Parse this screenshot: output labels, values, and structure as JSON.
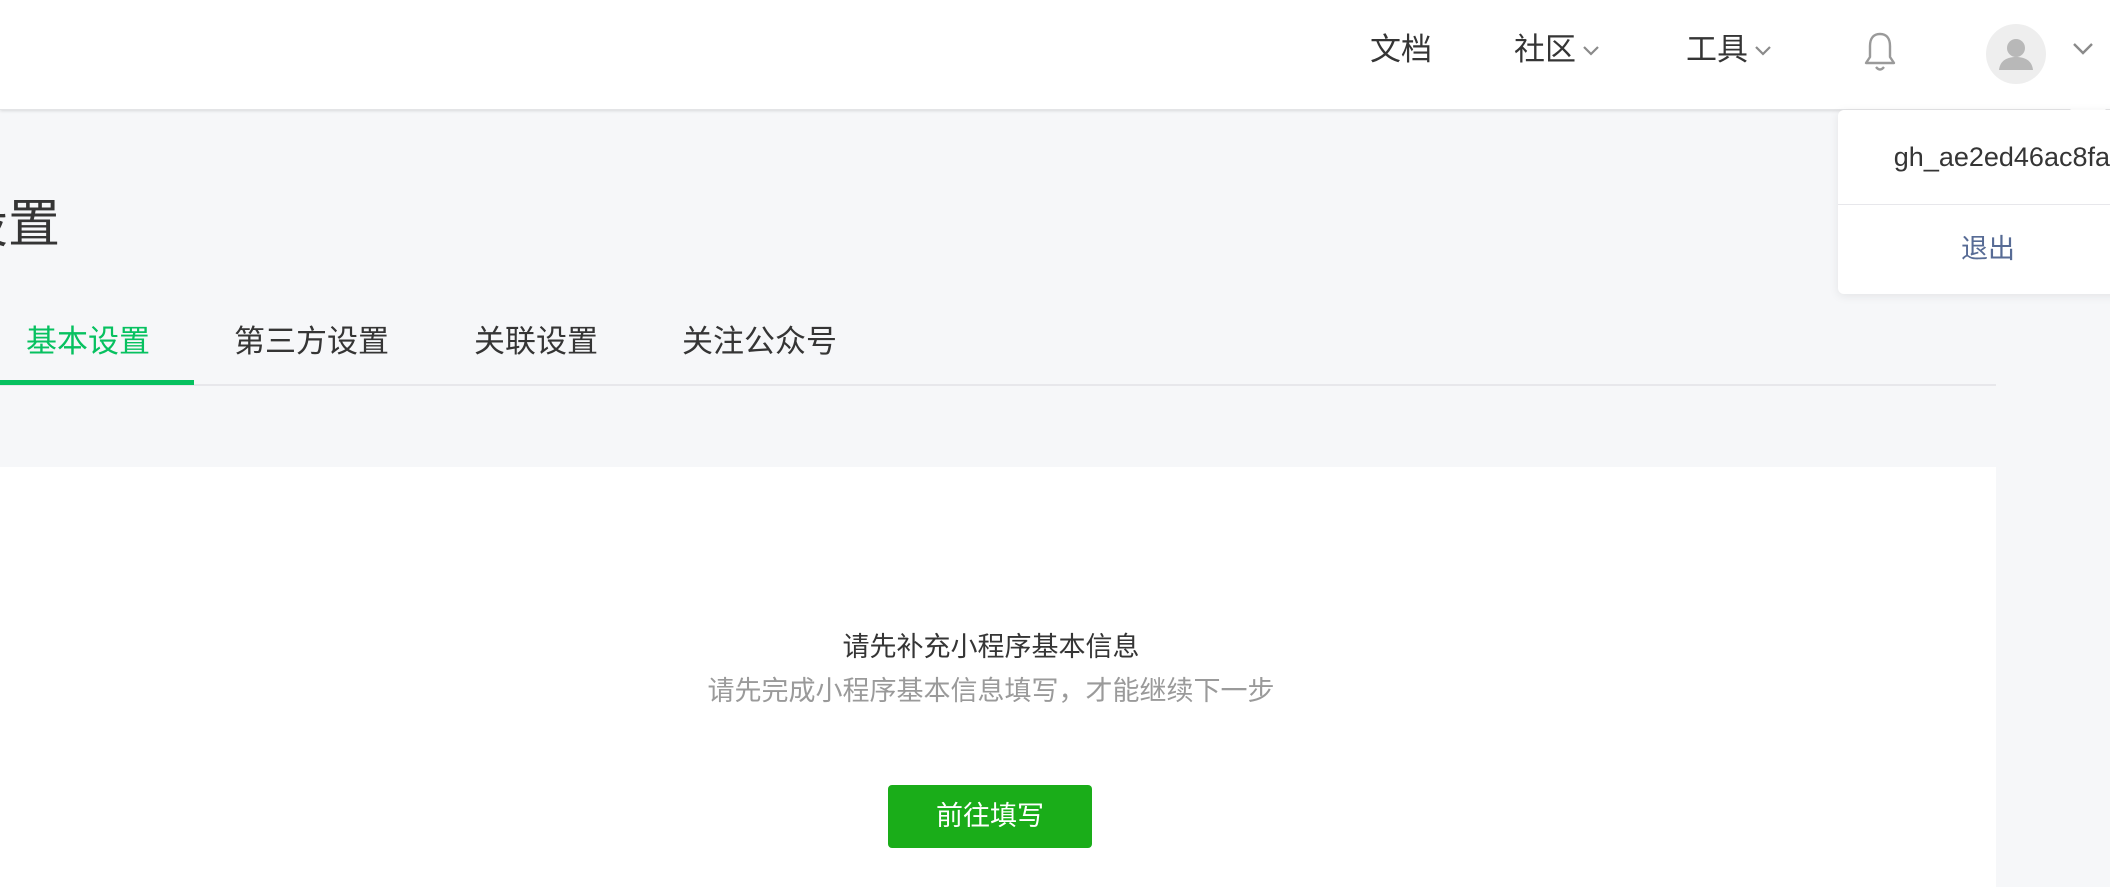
{
  "header": {
    "nav": [
      {
        "label": "文档",
        "has_dropdown": false
      },
      {
        "label": "社区",
        "has_dropdown": true
      },
      {
        "label": "工具",
        "has_dropdown": true
      }
    ],
    "icons": {
      "notifications": "bell-icon",
      "avatar": "user-avatar-icon",
      "account_menu": "chevron-down-icon"
    }
  },
  "account_menu": {
    "username": "gh_ae2ed46ac8fa",
    "logout_label": "退出"
  },
  "page": {
    "title": "设置",
    "tabs": [
      {
        "label": "基本设置",
        "active": true
      },
      {
        "label": "第三方设置",
        "active": false
      },
      {
        "label": "关联设置",
        "active": false
      },
      {
        "label": "关注公众号",
        "active": false
      }
    ]
  },
  "empty_state": {
    "title": "请先补充小程序基本信息",
    "description": "请先完成小程序基本信息填写，才能继续下一步",
    "button_label": "前往填写"
  },
  "colors": {
    "accent_green": "#07c160",
    "button_green": "#1aad19",
    "link_blue": "#576b95",
    "page_bg": "#f6f7f9"
  }
}
